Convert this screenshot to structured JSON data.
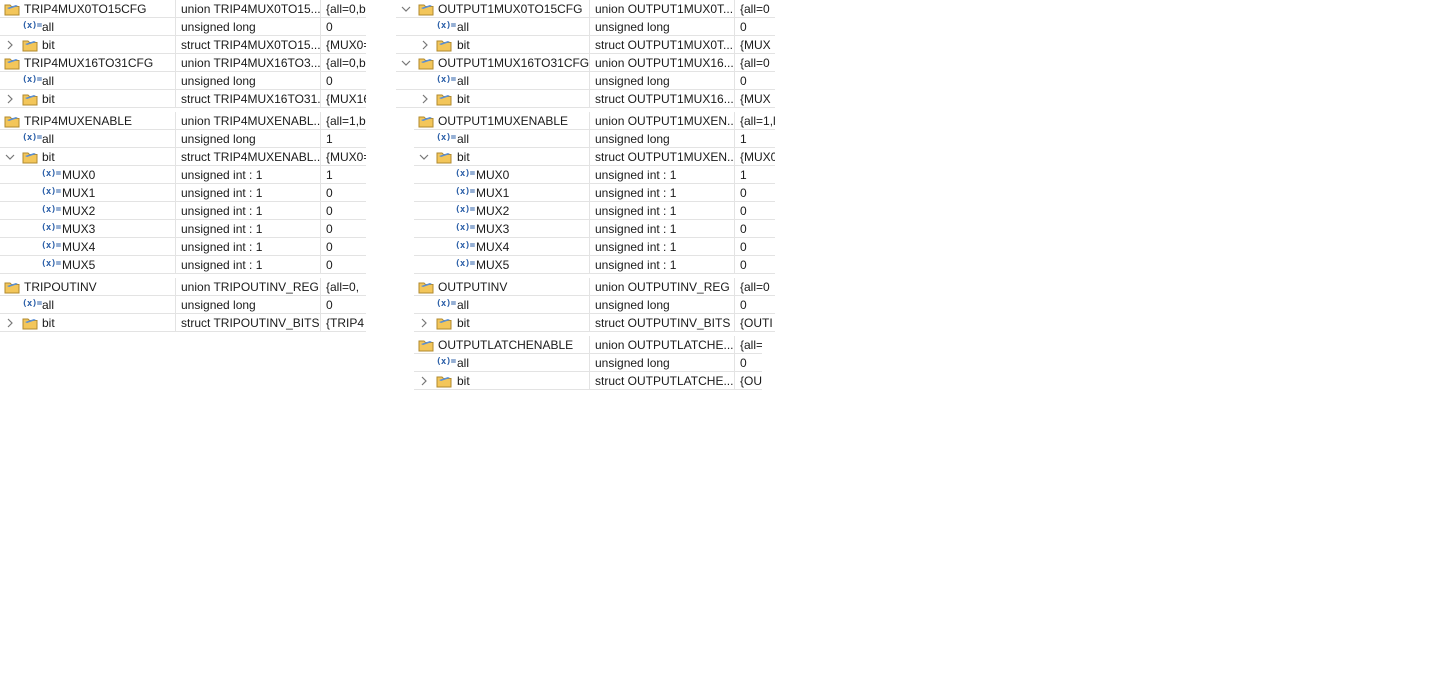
{
  "icons": {
    "struct": "folder-struct-icon",
    "variable": "variable-x-icon",
    "expanded": "chevron-down-icon",
    "collapsed": "chevron-right-icon"
  },
  "variable_glyph": "(x)=",
  "left": [
    {
      "name": "TRIP4MUX0TO15CFG",
      "type": "union TRIP4MUX0TO15...",
      "value": "{all=0,bi"
    },
    {
      "name": "all",
      "type": "unsigned long",
      "value": "0"
    },
    {
      "name": "bit",
      "type": "struct TRIP4MUX0TO15...",
      "value": "{MUX0="
    },
    {
      "name": "TRIP4MUX16TO31CFG",
      "type": "union TRIP4MUX16TO3...",
      "value": "{all=0,bi"
    },
    {
      "name": "all",
      "type": "unsigned long",
      "value": "0"
    },
    {
      "name": "bit",
      "type": "struct TRIP4MUX16TO31...",
      "value": "{MUX16"
    },
    {
      "name": "TRIP4MUXENABLE",
      "type": "union TRIP4MUXENABL...",
      "value": "{all=1,b"
    },
    {
      "name": "all",
      "type": "unsigned long",
      "value": "1"
    },
    {
      "name": "bit",
      "type": "struct TRIP4MUXENABL...",
      "value": "{MUX0="
    },
    {
      "name": "MUX0",
      "type": "unsigned int : 1",
      "value": "1"
    },
    {
      "name": "MUX1",
      "type": "unsigned int : 1",
      "value": "0"
    },
    {
      "name": "MUX2",
      "type": "unsigned int : 1",
      "value": "0"
    },
    {
      "name": "MUX3",
      "type": "unsigned int : 1",
      "value": "0"
    },
    {
      "name": "MUX4",
      "type": "unsigned int : 1",
      "value": "0"
    },
    {
      "name": "MUX5",
      "type": "unsigned int : 1",
      "value": "0"
    },
    {
      "name": "TRIPOUTINV",
      "type": "union TRIPOUTINV_REG",
      "value": "{all=0,"
    },
    {
      "name": "all",
      "type": "unsigned long",
      "value": "0"
    },
    {
      "name": "bit",
      "type": "struct TRIPOUTINV_BITS",
      "value": "{TRIP4"
    }
  ],
  "right": [
    {
      "name": "OUTPUT1MUX0TO15CFG",
      "type": "union OUTPUT1MUX0T...",
      "value": "{all=0"
    },
    {
      "name": "all",
      "type": "unsigned long",
      "value": "0"
    },
    {
      "name": "bit",
      "type": "struct OUTPUT1MUX0T...",
      "value": "{MUX"
    },
    {
      "name": "OUTPUT1MUX16TO31CFG",
      "type": "union OUTPUT1MUX16...",
      "value": "{all=0"
    },
    {
      "name": "all",
      "type": "unsigned long",
      "value": "0"
    },
    {
      "name": "bit",
      "type": "struct OUTPUT1MUX16...",
      "value": "{MUX"
    },
    {
      "name": "OUTPUT1MUXENABLE",
      "type": "union OUTPUT1MUXEN...",
      "value": "{all=1,l"
    },
    {
      "name": "all",
      "type": "unsigned long",
      "value": "1"
    },
    {
      "name": "bit",
      "type": "struct OUTPUT1MUXEN...",
      "value": "{MUX0"
    },
    {
      "name": "MUX0",
      "type": "unsigned int : 1",
      "value": "1"
    },
    {
      "name": "MUX1",
      "type": "unsigned int : 1",
      "value": "0"
    },
    {
      "name": "MUX2",
      "type": "unsigned int : 1",
      "value": "0"
    },
    {
      "name": "MUX3",
      "type": "unsigned int : 1",
      "value": "0"
    },
    {
      "name": "MUX4",
      "type": "unsigned int : 1",
      "value": "0"
    },
    {
      "name": "MUX5",
      "type": "unsigned int : 1",
      "value": "0"
    },
    {
      "name": "OUTPUTINV",
      "type": "union OUTPUTINV_REG",
      "value": "{all=0"
    },
    {
      "name": "all",
      "type": "unsigned long",
      "value": "0"
    },
    {
      "name": "bit",
      "type": "struct OUTPUTINV_BITS",
      "value": "{OUTI"
    },
    {
      "name": "OUTPUTLATCHENABLE",
      "type": "union OUTPUTLATCHE...",
      "value": "{all="
    },
    {
      "name": "all",
      "type": "unsigned long",
      "value": "0"
    },
    {
      "name": "bit",
      "type": "struct OUTPUTLATCHE...",
      "value": "{OU"
    }
  ]
}
